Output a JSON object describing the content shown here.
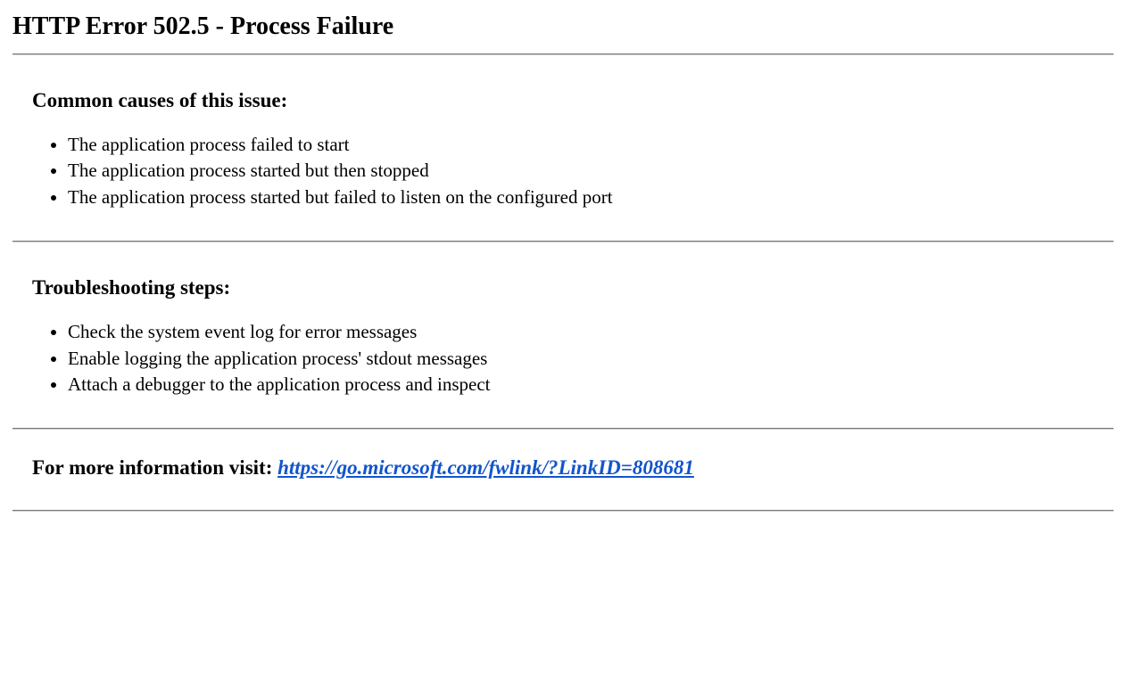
{
  "title": "HTTP Error 502.5 - Process Failure",
  "causes": {
    "heading": "Common causes of this issue:",
    "items": [
      "The application process failed to start",
      "The application process started but then stopped",
      "The application process started but failed to listen on the configured port"
    ]
  },
  "troubleshooting": {
    "heading": "Troubleshooting steps:",
    "items": [
      "Check the system event log for error messages",
      "Enable logging the application process' stdout messages",
      "Attach a debugger to the application process and inspect"
    ]
  },
  "more_info": {
    "label": "For more information visit: ",
    "link_text": "https://go.microsoft.com/fwlink/?LinkID=808681",
    "link_href": "https://go.microsoft.com/fwlink/?LinkID=808681"
  }
}
